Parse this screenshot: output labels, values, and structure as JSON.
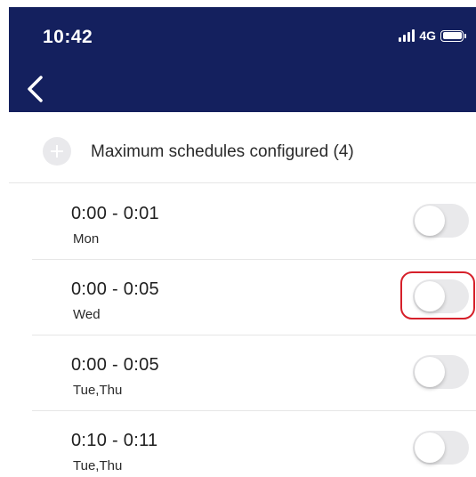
{
  "status_bar": {
    "time": "10:42",
    "network": "4G"
  },
  "nav": {
    "back_icon": "chevron-left-icon"
  },
  "add_schedule": {
    "icon": "plus-icon",
    "label": "Maximum schedules configured (4)",
    "enabled": false
  },
  "schedules": [
    {
      "time": "0:00 - 0:01",
      "days": "Mon",
      "enabled": false
    },
    {
      "time": "0:00 - 0:05",
      "days": "Wed",
      "enabled": false,
      "highlighted": true
    },
    {
      "time": "0:00 - 0:05",
      "days": "Tue,Thu",
      "enabled": false
    },
    {
      "time": "0:10 - 0:11",
      "days": "Tue,Thu",
      "enabled": false
    }
  ],
  "colors": {
    "header_bg": "#14205e",
    "toggle_off": "#e9e9eb",
    "highlight": "#d6202a"
  }
}
